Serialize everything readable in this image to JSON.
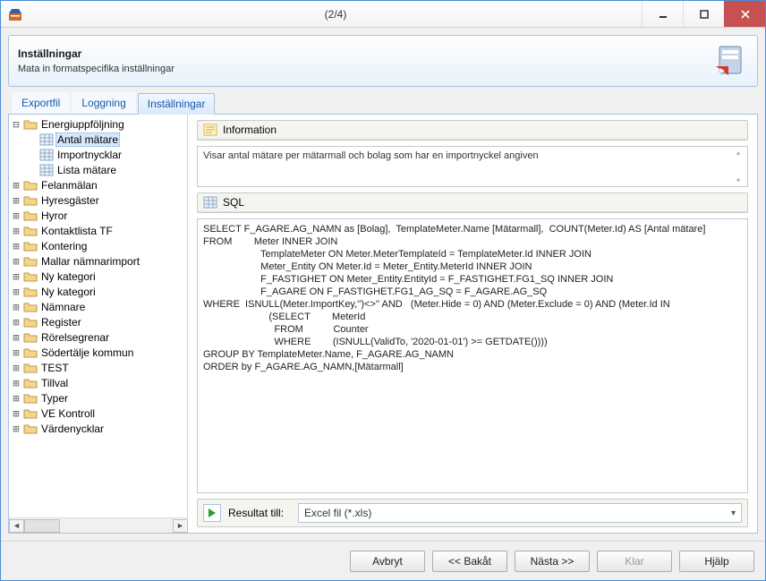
{
  "window": {
    "title": "(2/4)"
  },
  "header": {
    "title": "Inställningar",
    "subtitle": "Mata in formatspecifika inställningar"
  },
  "tabs": {
    "exportfil": "Exportfil",
    "loggning": "Loggning",
    "installningar": "Inställningar"
  },
  "tree": {
    "energi": "Energiuppföljning",
    "antal": "Antal mätare",
    "importnycklar": "Importnycklar",
    "lista": "Lista mätare",
    "felanmalan": "Felanmälan",
    "hyresgaster": "Hyresgäster",
    "hyror": "Hyror",
    "kontaktlista": "Kontaktlista TF",
    "kontering": "Kontering",
    "mallar": "Mallar nämnarimport",
    "nykat1": "Ny kategori",
    "nykat2": "Ny kategori",
    "namnare": "Nämnare",
    "register": "Register",
    "rorelsegrenar": "Rörelsegrenar",
    "sodertalje": "Södertälje kommun",
    "test": "TEST",
    "tillval": "Tillval",
    "typer": "Typer",
    "vekontroll": "VE Kontroll",
    "vardenycklar": "Värdenycklar"
  },
  "right": {
    "information_label": "Information",
    "information_text": "Visar antal mätare per mätarmall och bolag som har en importnyckel angiven",
    "sql_label": "SQL",
    "sql_text": "SELECT F_AGARE.AG_NAMN as [Bolag],  TemplateMeter.Name [Mätarmall],  COUNT(Meter.Id) AS [Antal mätare]\nFROM        Meter INNER JOIN\n                     TemplateMeter ON Meter.MeterTemplateId = TemplateMeter.Id INNER JOIN\n                     Meter_Entity ON Meter.Id = Meter_Entity.MeterId INNER JOIN\n                     F_FASTIGHET ON Meter_Entity.EntityId = F_FASTIGHET.FG1_SQ INNER JOIN\n                     F_AGARE ON F_FASTIGHET.FG1_AG_SQ = F_AGARE.AG_SQ\nWHERE  ISNULL(Meter.ImportKey,'')<>'' AND   (Meter.Hide = 0) AND (Meter.Exclude = 0) AND (Meter.Id IN\n                        (SELECT        MeterId\n                          FROM           Counter\n                          WHERE        (ISNULL(ValidTo, '2020-01-01') >= GETDATE())))\nGROUP BY TemplateMeter.Name, F_AGARE.AG_NAMN\nORDER by F_AGARE.AG_NAMN,[Mätarmall]",
    "result_label": "Resultat till:",
    "result_value": "Excel fil (*.xls)"
  },
  "buttons": {
    "avbryt": "Avbryt",
    "bakat": "<< Bakåt",
    "nasta": "Nästa >>",
    "klar": "Klar",
    "hjalp": "Hjälp"
  }
}
